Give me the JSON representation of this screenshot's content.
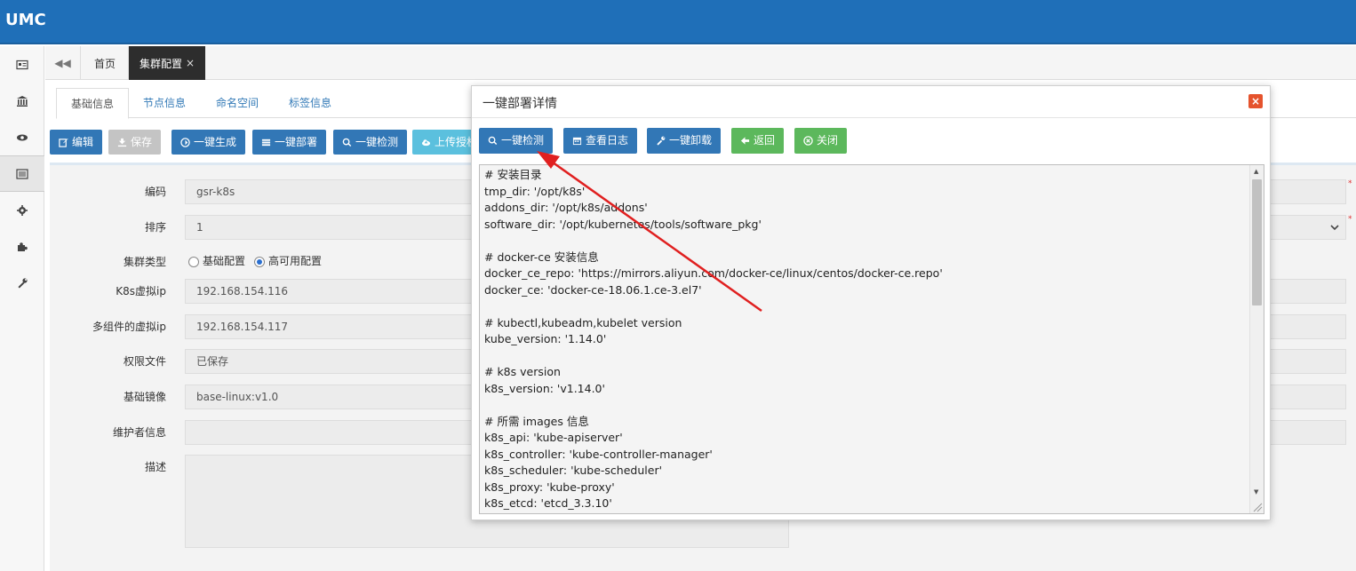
{
  "app": {
    "logo": "UMC"
  },
  "tabs": {
    "home": "首页",
    "cluster": "集群配置",
    "close": "×"
  },
  "subtabs": [
    "基础信息",
    "节点信息",
    "命名空间",
    "标签信息"
  ],
  "toolbar": {
    "edit": "编辑",
    "save": "保存",
    "generate": "一键生成",
    "deploy": "一键部署",
    "check": "一键检测",
    "upload": "上传授权"
  },
  "form": {
    "code_label": "编码",
    "code_value": "gsr-k8s",
    "order_label": "排序",
    "order_value": "1",
    "type_label": "集群类型",
    "type_basic": "基础配置",
    "type_ha": "高可用配置",
    "vip_label": "K8s虚拟ip",
    "vip_value": "192.168.154.116",
    "multi_vip_label": "多组件的虚拟ip",
    "multi_vip_value": "192.168.154.117",
    "auth_label": "权限文件",
    "auth_value": "已保存",
    "image_label": "基础镜像",
    "image_value": "base-linux:v1.0",
    "maintainer_label": "维护者信息",
    "maintainer_value": "",
    "desc_label": "描述",
    "desc_value": ""
  },
  "modal": {
    "title": "一键部署详情",
    "close": "×",
    "buttons": {
      "check": "一键检测",
      "log": "查看日志",
      "uninstall": "一键卸载",
      "back": "返回",
      "close": "关闭"
    },
    "log_lines": [
      "# 安装目录",
      "tmp_dir: '/opt/k8s'",
      "addons_dir: '/opt/k8s/addons'",
      "software_dir: '/opt/kubernetes/tools/software_pkg'",
      "",
      "# docker-ce 安装信息",
      "docker_ce_repo: 'https://mirrors.aliyun.com/docker-ce/linux/centos/docker-ce.repo'",
      "docker_ce: 'docker-ce-18.06.1.ce-3.el7'",
      "",
      "# kubectl,kubeadm,kubelet version",
      "kube_version: '1.14.0'",
      "",
      "# k8s version",
      "k8s_version: 'v1.14.0'",
      "",
      "# 所需 images 信息",
      "k8s_api: 'kube-apiserver'",
      "k8s_controller: 'kube-controller-manager'",
      "k8s_scheduler: 'kube-scheduler'",
      "k8s_proxy: 'kube-proxy'",
      "k8s_etcd: 'etcd_3.3.10'"
    ]
  },
  "colors": {
    "topbar": "#1f6fb8",
    "primary": "#3277b6",
    "info": "#5bc0de",
    "success": "#5cb85c",
    "danger": "#e5532d",
    "arrow": "#e02020"
  }
}
